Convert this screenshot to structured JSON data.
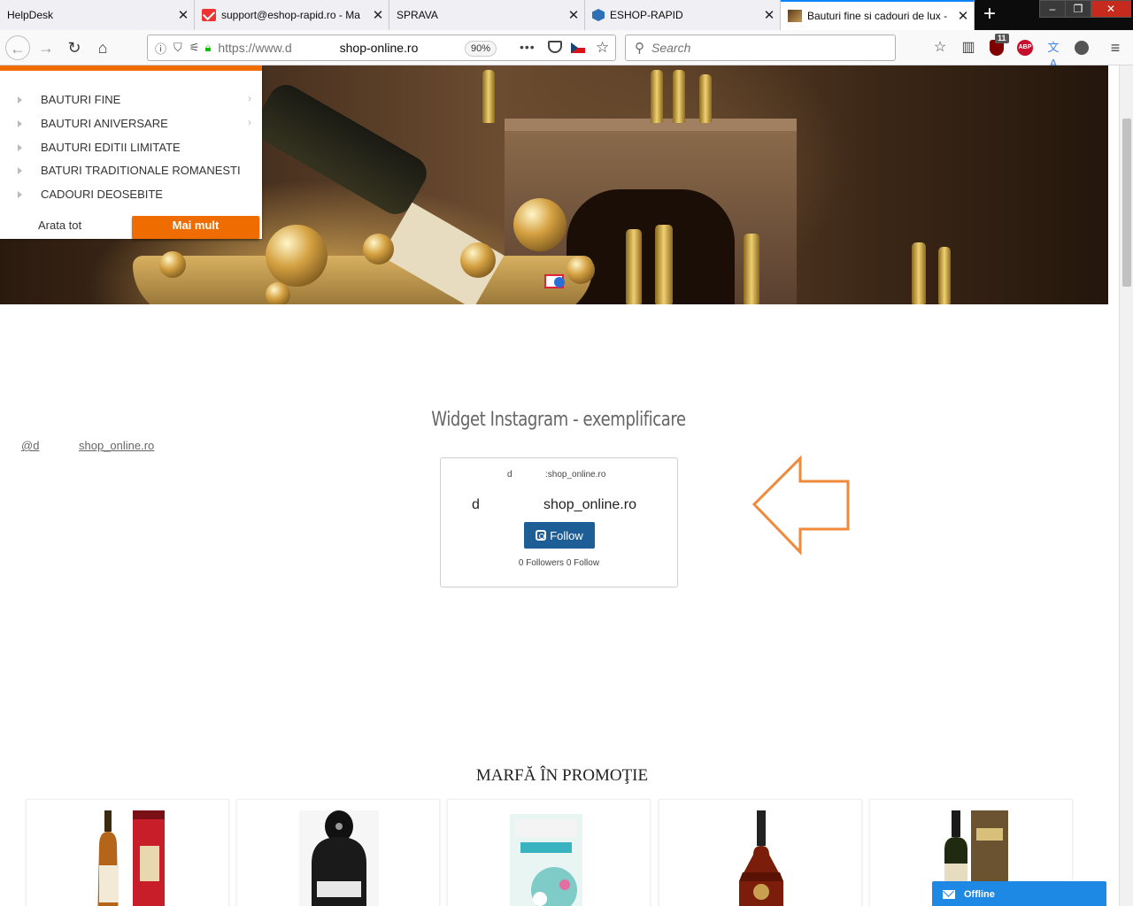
{
  "browser": {
    "tabs": [
      {
        "title": "HelpDesk",
        "active": false
      },
      {
        "title": "support@eshop-rapid.ro - Ma",
        "active": false
      },
      {
        "title": "SPRAVA",
        "active": false
      },
      {
        "title": "ESHOP-RAPID",
        "active": false
      },
      {
        "title": "Bauturi fine si cadouri de lux -",
        "active": true
      }
    ],
    "tab_close_glyph": "✕",
    "new_tab_glyph": "+",
    "url_prefix": "https://www.d",
    "url_host": "shop-online.ro",
    "zoom": "90%",
    "search_placeholder": "Search",
    "ublock_badge": "11",
    "abp_label": "ABP",
    "window_controls": [
      "–",
      "❐",
      "✕"
    ]
  },
  "category_menu": {
    "items": [
      {
        "label": "BAUTURI FINE",
        "has_submenu": true
      },
      {
        "label": "BAUTURI ANIVERSARE",
        "has_submenu": true
      },
      {
        "label": "BAUTURI EDITII LIMITATE",
        "has_submenu": false
      },
      {
        "label": "BATURI TRADITIONALE ROMANESTI",
        "has_submenu": false
      },
      {
        "label": "CADOURI DEOSEBITE",
        "has_submenu": false
      }
    ],
    "show_all_label": "Arata tot",
    "more_label": "Mai mult",
    "chevron_glyph": "›",
    "accent_color": "#ef6c00"
  },
  "instagram": {
    "section_title": "Widget Instagram - exemplificare",
    "link_part1": "@d",
    "link_part2": "shop_online.ro",
    "card_handle_part1": "d",
    "card_handle_part2": ":shop_online.ro",
    "card_name_part1": "d",
    "card_name_part2": "shop_online.ro",
    "follow_label": "Follow",
    "stats": "0 Followers 0 Follow",
    "button_color": "#1e5e96"
  },
  "promo": {
    "title": "MARFĂ ÎN PROMOŢIE",
    "products": [
      {
        "icon": "whisky-bottle-with-red-tube"
      },
      {
        "icon": "cream-liqueur-bottle"
      },
      {
        "icon": "jasmine-tea-box"
      },
      {
        "icon": "cognac-bottle"
      },
      {
        "icon": "scotch-bottle-with-box"
      }
    ]
  },
  "chat": {
    "label": "Offline",
    "color": "#1e88e5"
  }
}
